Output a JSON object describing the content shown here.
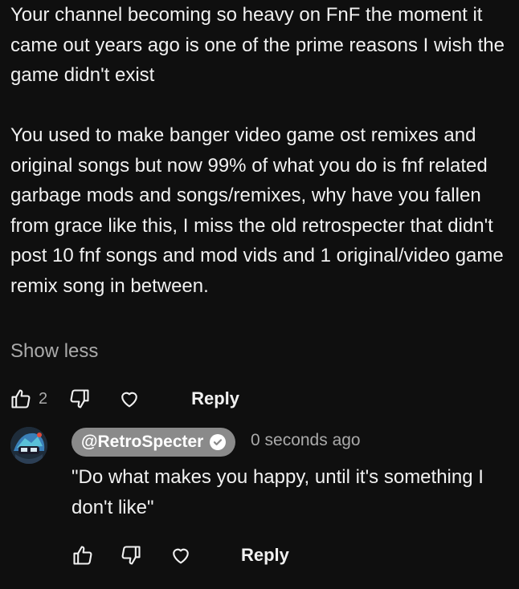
{
  "comment": {
    "text": "Your channel becoming so heavy on FnF the moment it came out years ago is one of the prime reasons I wish the game didn't exist\n\nYou used to make banger video game ost remixes and original songs but now 99% of what you do is fnf related garbage mods and songs/remixes, why have you fallen from grace like this, I miss the old retrospecter that didn't post 10 fnf songs and mod vids and 1 original/video game remix song in between.",
    "show_less_label": "Show less",
    "like_count": "2",
    "reply_label": "Reply",
    "icons": [
      "thumbs-up-icon",
      "thumbs-down-icon",
      "heart-icon"
    ]
  },
  "reply": {
    "author": "@RetroSpecter",
    "timestamp": "0 seconds ago",
    "text": "\"Do what makes you happy, until it's something I don't like\"",
    "reply_label": "Reply",
    "icons": [
      "avatar",
      "verified-check-icon",
      "thumbs-up-icon",
      "thumbs-down-icon",
      "heart-icon"
    ]
  },
  "colors": {
    "background": "#0f0f0f",
    "text": "#f1f1f1",
    "secondary_text": "#aaaaaa",
    "author_chip": "#8a8a8a"
  }
}
